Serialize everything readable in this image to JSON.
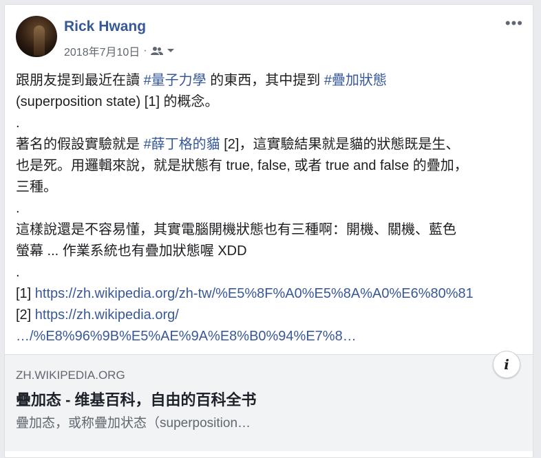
{
  "post": {
    "author": "Rick Hwang",
    "date": "2018年7月10日",
    "separator": "·",
    "audience_icon": "friends-icon",
    "menu_icon": "•••",
    "lines": [
      {
        "a": "跟朋友提到最近在讀 ",
        "tag1": "#量子力學",
        "b": " 的東西，其中提到 ",
        "tag2": "#疊加狀態"
      },
      {
        "text": "(superposition state) [1] 的概念。"
      },
      {
        "text": "."
      },
      {
        "a": "著名的假設實驗就是 ",
        "tag": "#薛丁格的貓",
        "b": " [2]，這實驗結果就是貓的狀態既是生、"
      },
      {
        "text": "也是死。用邏輯來說，就是狀態有 true, false, 或者 true and false 的疊加，"
      },
      {
        "text": "三種。"
      },
      {
        "text": "."
      },
      {
        "text": "這樣說還是不容易懂，其實電腦開機狀態也有三種啊：開機、關機、藍色"
      },
      {
        "text": "螢幕 ... 作業系統也有疊加狀態喔 XDD"
      },
      {
        "text": "."
      },
      {
        "ref": "[1] ",
        "url": "https://zh.wikipedia.org/zh-tw/%E5%8F%A0%E5%8A%A0%E6%80%81"
      },
      {
        "ref": "[2] ",
        "url": "https://zh.wikipedia.org/"
      },
      {
        "url": "…/%E8%96%9B%E5%AE%9A%E8%B0%94%E7%8…"
      }
    ]
  },
  "preview": {
    "domain": "ZH.WIKIPEDIA.ORG",
    "title": "疊加态 - 维基百科，自由的百科全书",
    "description": "疊加态，或称疊加状态（superposition…",
    "info_label": "i"
  },
  "colors": {
    "link": "#385898",
    "author": "#365899",
    "background": "#e9ebee"
  }
}
